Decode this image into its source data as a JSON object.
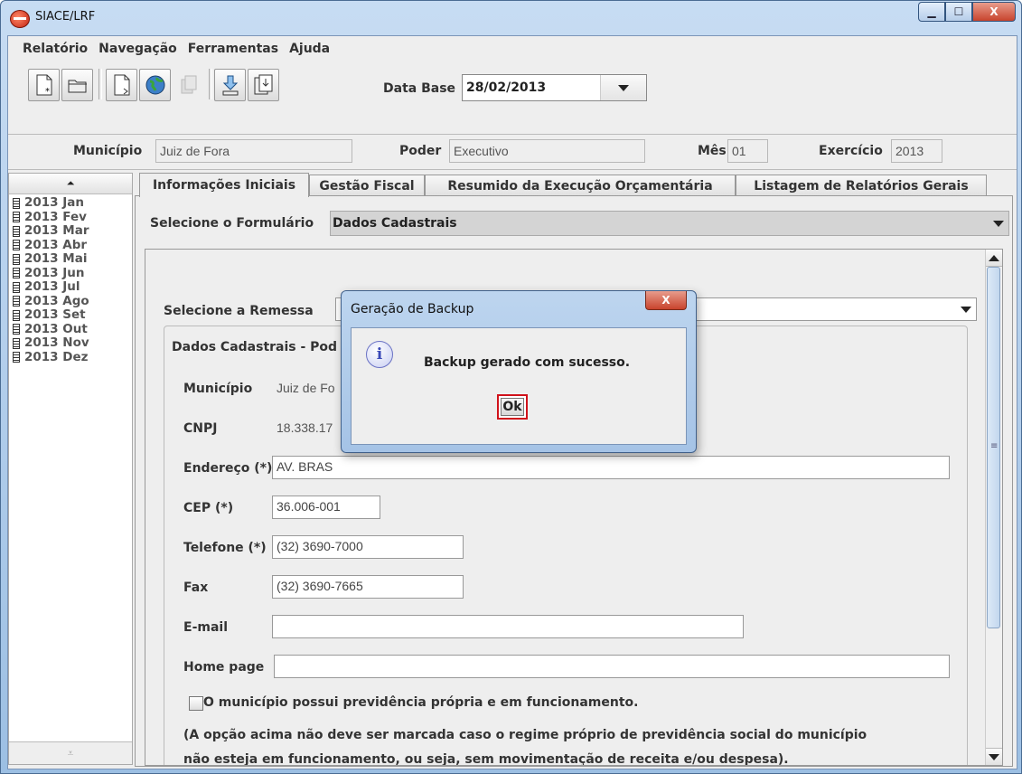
{
  "window": {
    "title": "SIACE/LRF",
    "min_glyph": "▁",
    "max_glyph": "☐",
    "close_glyph": "X"
  },
  "menubar": {
    "items": [
      "Relatório",
      "Navegação",
      "Ferramentas",
      "Ajuda"
    ]
  },
  "toolbar": {
    "date_label": "Data Base",
    "date_value": "28/02/2013"
  },
  "infobar": {
    "municipio_label": "Município",
    "municipio_value": "Juiz de Fora",
    "poder_label": "Poder",
    "poder_value": "Executivo",
    "mes_label": "Mês",
    "mes_value": "01",
    "exercicio_label": "Exercício",
    "exercicio_value": "2013"
  },
  "sidebar": {
    "head_glyph": "⏶",
    "foot_glyph": "⩡",
    "items": [
      "2013 Jan",
      "2013 Fev",
      "2013 Mar",
      "2013 Abr",
      "2013 Mai",
      "2013 Jun",
      "2013 Jul",
      "2013 Ago",
      "2013 Set",
      "2013 Out",
      "2013 Nov",
      "2013 Dez"
    ]
  },
  "tabs": [
    "Informações Iniciais",
    "Gestão Fiscal",
    "Resumido da Execução Orçamentária",
    "Listagem de Relatórios Gerais"
  ],
  "form": {
    "selector_label": "Selecione o Formulário",
    "selector_value": "Dados Cadastrais",
    "remessa_label": "Selecione a Remessa",
    "remessa_value": "",
    "group_title": "Dados Cadastrais - Pod",
    "fields": {
      "municipio_label": "Município",
      "municipio_value": "Juiz de Fo",
      "cnpj_label": "CNPJ",
      "cnpj_value": "18.338.17",
      "endereco_label": "Endereço (*)",
      "endereco_value": "AV. BRAS",
      "cep_label": "CEP (*)",
      "cep_value": "36.006-001",
      "telefone_label": "Telefone (*)",
      "telefone_value": "(32) 3690-7000",
      "fax_label": "Fax",
      "fax_value": "(32) 3690-7665",
      "email_label": "E-mail",
      "email_value": "",
      "homepage_label": "Home page",
      "homepage_value": ""
    },
    "checkbox_label": "O município possui previdência própria e em funcionamento.",
    "checkbox_checked": false,
    "note_line1": "(A opção acima não deve ser marcada caso o regime próprio de previdência social do município",
    "note_line2": "não esteja em funcionamento, ou seja, sem movimentação de receita e/ou despesa)."
  },
  "dialog": {
    "title": "Geração de Backup",
    "close_glyph": "X",
    "icon_glyph": "i",
    "message": "Backup gerado com sucesso.",
    "ok_label": "Ok"
  },
  "colors": {
    "highlight_border": "#d0121b",
    "title_gradient_top": "#c7dcf3"
  }
}
